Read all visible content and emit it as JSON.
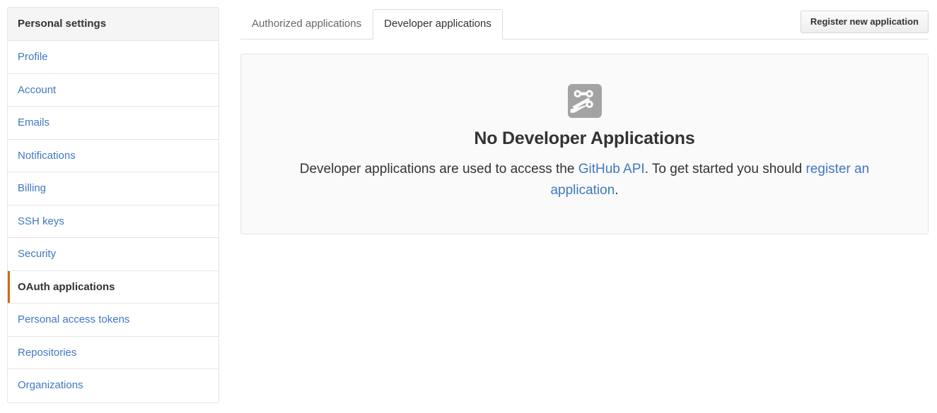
{
  "sidebar": {
    "header": "Personal settings",
    "items": [
      {
        "label": "Profile",
        "selected": false
      },
      {
        "label": "Account",
        "selected": false
      },
      {
        "label": "Emails",
        "selected": false
      },
      {
        "label": "Notifications",
        "selected": false
      },
      {
        "label": "Billing",
        "selected": false
      },
      {
        "label": "SSH keys",
        "selected": false
      },
      {
        "label": "Security",
        "selected": false
      },
      {
        "label": "OAuth applications",
        "selected": true
      },
      {
        "label": "Personal access tokens",
        "selected": false
      },
      {
        "label": "Repositories",
        "selected": false
      },
      {
        "label": "Organizations",
        "selected": false
      }
    ]
  },
  "tabs": [
    {
      "label": "Authorized applications",
      "active": false
    },
    {
      "label": "Developer applications",
      "active": true
    }
  ],
  "actions": {
    "register_new_application": "Register new application"
  },
  "blankslate": {
    "icon": "circuit-board-icon",
    "title": "No Developer Applications",
    "text_part1": "Developer applications are used to access the ",
    "link1": "GitHub API",
    "text_part2": ". To get started you should ",
    "link2": "register an application",
    "text_part3": "."
  },
  "colors": {
    "link": "#4078c0",
    "selected_accent": "#d26911",
    "sidebar_header_bg": "#f5f5f5",
    "blankslate_bg": "#fafafa",
    "border": "#e5e5e5",
    "icon_gray": "#a3a3a3",
    "text": "#333333",
    "muted_text": "#666666"
  }
}
